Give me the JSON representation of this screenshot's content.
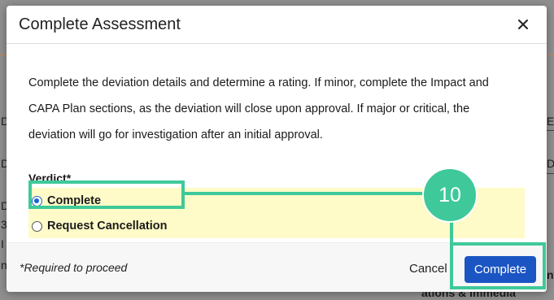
{
  "background": {
    "fragments": [
      "D",
      "D",
      "D",
      "3",
      "I",
      "n",
      "E",
      "D",
      "nt",
      "ations & Immedia"
    ]
  },
  "dialog": {
    "title": "Complete Assessment",
    "close_icon": "close-icon",
    "instructions": "Complete the deviation details and determine a rating. If minor, complete the Impact and CAPA Plan sections, as the deviation will close upon approval. If major or critical, the deviation will go for investigation after an initial approval.",
    "verdict": {
      "label": "Verdict*",
      "options": [
        {
          "label": "Complete",
          "checked": true
        },
        {
          "label": "Request Cancellation",
          "checked": false
        }
      ]
    },
    "footer": {
      "required_note": "*Required to proceed",
      "cancel_label": "Cancel",
      "complete_label": "Complete"
    }
  },
  "annotation": {
    "step_number": "10",
    "color": "#3fc99a"
  },
  "colors": {
    "primary_button": "#1b55c4",
    "radio_accent": "#1b64d6",
    "verdict_highlight": "#fefbc8"
  }
}
